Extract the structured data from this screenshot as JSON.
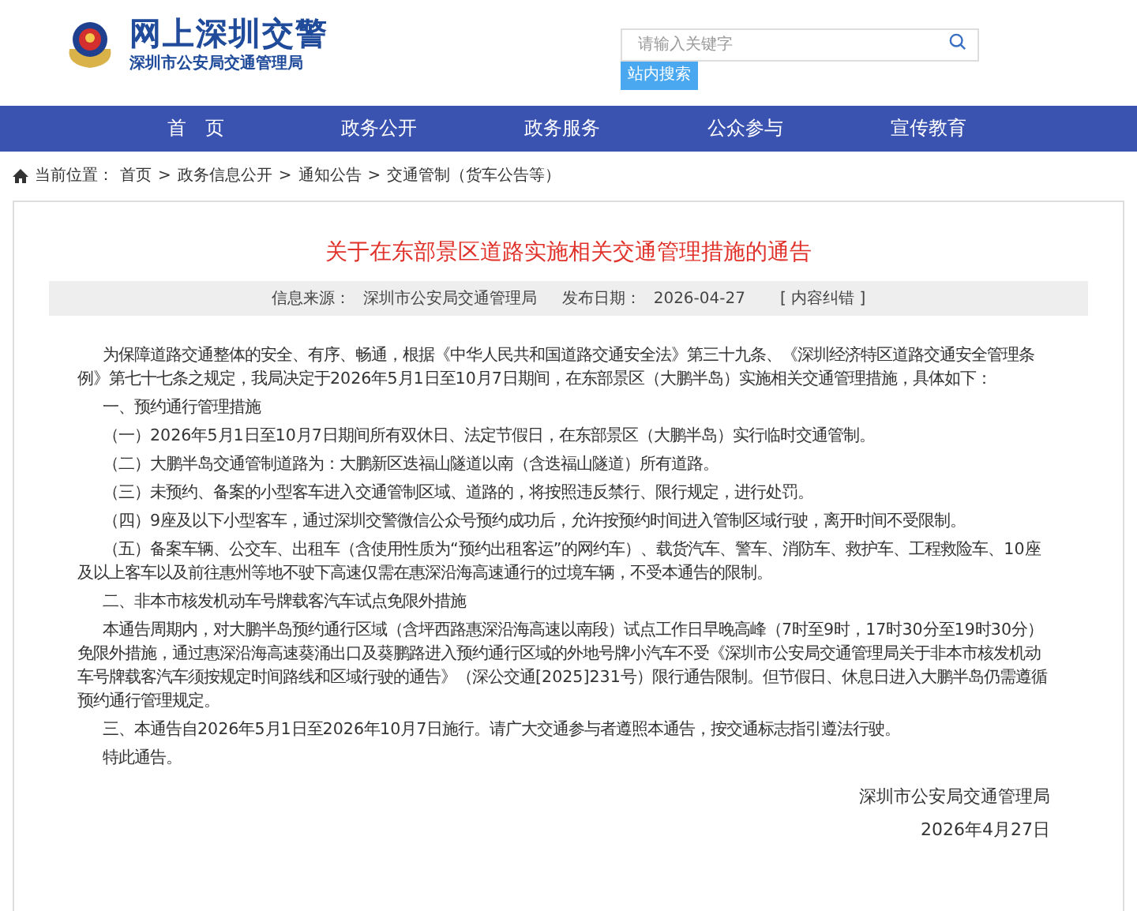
{
  "header": {
    "title": "网上深圳交警",
    "subtitle": "深圳市公安局交通管理局",
    "search": {
      "placeholder": "请输入关键字",
      "button": "站内搜索"
    }
  },
  "nav": [
    {
      "label": "首　页"
    },
    {
      "label": "政务公开"
    },
    {
      "label": "政务服务"
    },
    {
      "label": "公众参与"
    },
    {
      "label": "宣传教育"
    }
  ],
  "breadcrumb": {
    "label": "当前位置：",
    "separator": ">",
    "items": [
      "首页",
      "政务信息公开",
      "通知公告",
      "交通管制（货车公告等）"
    ]
  },
  "article": {
    "title": "关于在东部景区道路实施相关交通管理措施的通告",
    "meta": {
      "source_label": "信息来源：",
      "source": "深圳市公安局交通管理局",
      "date_label": "发布日期：",
      "date": "2026-04-27",
      "feedback": "[ 内容纠错 ]"
    },
    "paragraphs": [
      "为保障道路交通整体的安全、有序、畅通，根据《中华人民共和国道路交通安全法》第三十九条、《深圳经济特区道路交通安全管理条例》第七十七条之规定，我局决定于2026年5月1日至10月7日期间，在东部景区（大鹏半岛）实施相关交通管理措施，具体如下：",
      "一、预约通行管理措施",
      "（一）2026年5月1日至10月7日期间所有双休日、法定节假日，在东部景区（大鹏半岛）实行临时交通管制。",
      "（二）大鹏半岛交通管制道路为：大鹏新区迭福山隧道以南（含迭福山隧道）所有道路。",
      "（三）未预约、备案的小型客车进入交通管制区域、道路的，将按照违反禁行、限行规定，进行处罚。",
      "（四）9座及以下小型客车，通过深圳交警微信公众号预约成功后，允许按预约时间进入管制区域行驶，离开时间不受限制。",
      "（五）备案车辆、公交车、出租车（含使用性质为“预约出租客运”的网约车）、载货汽车、警车、消防车、救护车、工程救险车、10座及以上客车以及前往惠州等地不驶下高速仅需在惠深沿海高速通行的过境车辆，不受本通告的限制。",
      "二、非本市核发机动车号牌载客汽车试点免限外措施",
      "本通告周期内，对大鹏半岛预约通行区域（含坪西路惠深沿海高速以南段）试点工作日早晚高峰（7时至9时，17时30分至19时30分）免限外措施，通过惠深沿海高速葵涌出口及葵鹏路进入预约通行区域的外地号牌小汽车不受《深圳市公安局交通管理局关于非本市核发机动车号牌载客汽车须按规定时间路线和区域行驶的通告》（深公交通[2025]231号）限行通告限制。但节假日、休息日进入大鹏半岛仍需遵循预约通行管理规定。",
      "三、本通告自2026年5月1日至2026年10月7日施行。请广大交通参与者遵照本通告，按交通标志指引遵法行驶。",
      "特此通告。"
    ],
    "signature": {
      "org": "深圳市公安局交通管理局",
      "date": "2026年4月27日"
    }
  }
}
